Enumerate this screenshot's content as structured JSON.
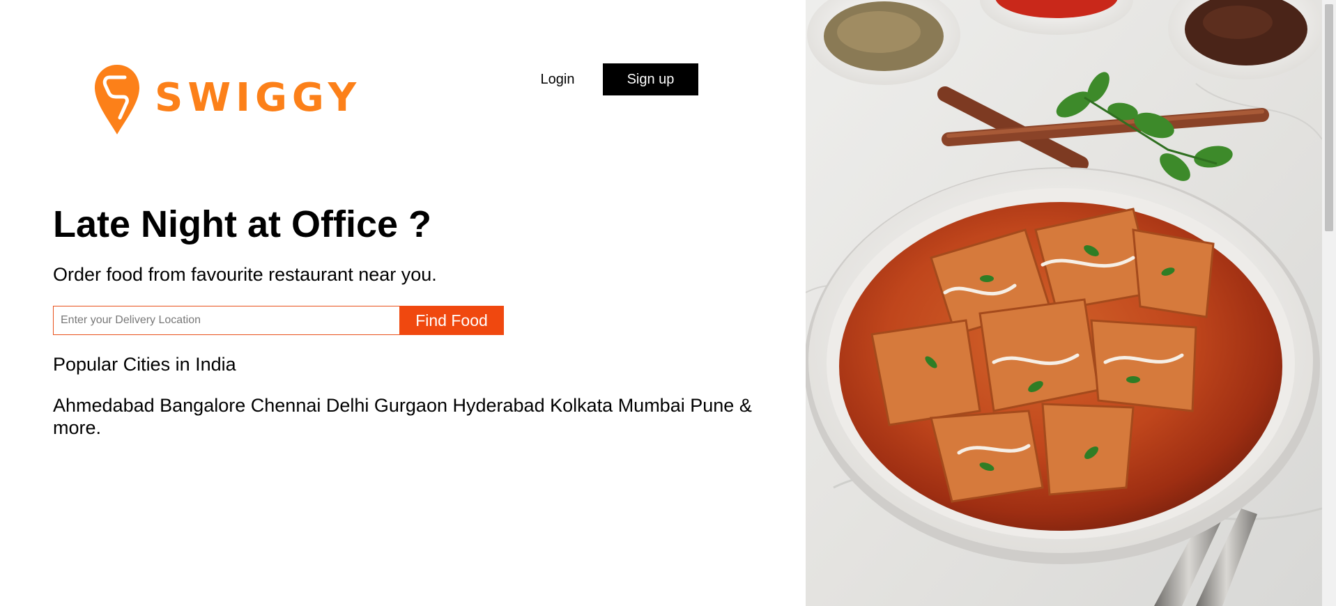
{
  "brand": {
    "name": "SWIGGY",
    "logo_icon": "swiggy-pin-logo-icon",
    "color": "#fc8019"
  },
  "header": {
    "login_label": "Login",
    "signup_label": "Sign up"
  },
  "hero": {
    "title": "Late Night at Office ?",
    "subtitle": "Order food from favourite restaurant near you."
  },
  "search": {
    "placeholder": "Enter your Delivery Location",
    "value": "",
    "button_label": "Find Food",
    "accent_color": "#f0480f"
  },
  "popular": {
    "heading": "Popular Cities in India",
    "cities": [
      "Ahmedabad",
      "Bangalore",
      "Chennai",
      "Delhi",
      "Gurgaon",
      "Hyderabad",
      "Kolkata",
      "Mumbai",
      "Pune"
    ],
    "more_label": "& more."
  },
  "banner": {
    "image_icon": "paneer-curry-food-image"
  }
}
